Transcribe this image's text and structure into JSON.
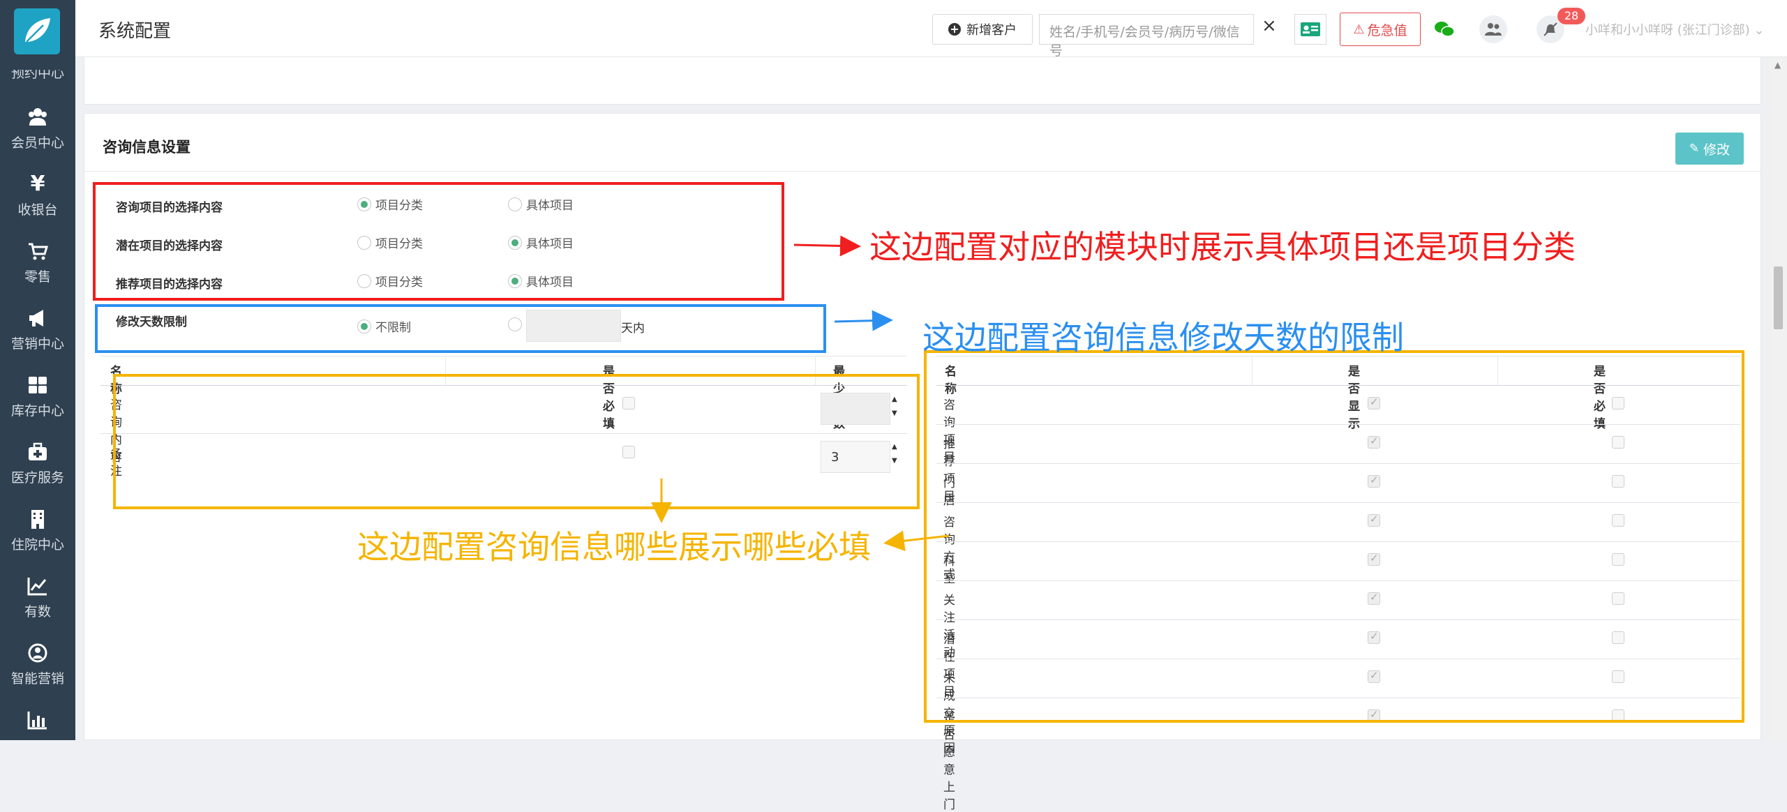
{
  "sidebar": {
    "items": [
      {
        "label": "预约中心",
        "icon": "calendar-icon"
      },
      {
        "label": "会员中心",
        "icon": "members-icon"
      },
      {
        "label": "收银台",
        "icon": "yen-icon"
      },
      {
        "label": "零售",
        "icon": "cart-icon"
      },
      {
        "label": "营销中心",
        "icon": "megaphone-icon"
      },
      {
        "label": "库存中心",
        "icon": "grid-icon"
      },
      {
        "label": "医疗服务",
        "icon": "medkit-icon"
      },
      {
        "label": "住院中心",
        "icon": "building-icon"
      },
      {
        "label": "有数",
        "icon": "line-chart-icon"
      },
      {
        "label": "智能营销",
        "icon": "smart-icon"
      },
      {
        "label": "",
        "icon": "bar-chart-icon"
      }
    ]
  },
  "topbar": {
    "title": "系统配置",
    "add_customer": "新增客户",
    "search_placeholder": "姓名/手机号/会员号/病历号/微信号",
    "clear": "×",
    "danger_label": "危急值",
    "notification_count": "28",
    "user": "小咩和小小咩呀 (张江门诊部)"
  },
  "panel": {
    "title": "咨询信息设置",
    "edit_button": "修改"
  },
  "selection_rows": [
    {
      "label": "咨询项目的选择内容",
      "option_a": "项目分类",
      "option_b": "具体项目",
      "selected": "a"
    },
    {
      "label": "潜在项目的选择内容",
      "option_a": "项目分类",
      "option_b": "具体项目",
      "selected": "b"
    },
    {
      "label": "推荐项目的选择内容",
      "option_a": "项目分类",
      "option_b": "具体项目",
      "selected": "b"
    }
  ],
  "days_limit": {
    "label": "修改天数限制",
    "no_limit": "不限制",
    "unit": "天内"
  },
  "left_table": {
    "headers": [
      "名称",
      "是否必填",
      "最少字数"
    ],
    "rows": [
      {
        "name": "咨询内容",
        "required": false,
        "min_chars": ""
      },
      {
        "name": "备注",
        "required": false,
        "min_chars": "3"
      }
    ]
  },
  "right_table": {
    "headers": [
      "名称",
      "是否显示",
      "是否必填"
    ],
    "rows": [
      {
        "name": "咨询项目",
        "show": true,
        "required": false
      },
      {
        "name": "推荐项目",
        "show": true,
        "required": false
      },
      {
        "name": "门店",
        "show": true,
        "required": false
      },
      {
        "name": "咨询方式",
        "show": true,
        "required": false
      },
      {
        "name": "科室",
        "show": true,
        "required": false
      },
      {
        "name": "关注活动",
        "show": true,
        "required": false
      },
      {
        "name": "潜在项目",
        "show": true,
        "required": false
      },
      {
        "name": "未成交原因",
        "show": true,
        "required": false
      },
      {
        "name": "是否愿意上门",
        "show": true,
        "required": false
      }
    ]
  },
  "annotations": {
    "red": "这边配置对应的模块时展示具体项目还是项目分类",
    "blue": "这边配置咨询信息修改天数的限制",
    "orange": "这边配置咨询信息哪些展示哪些必填"
  },
  "colors": {
    "sidebar_bg": "#2f4050",
    "accent_teal": "#5cc4c8",
    "radio_green": "#4cae7c",
    "annot_red": "#f01e1e",
    "annot_blue": "#2b8ff0",
    "annot_orange": "#f5b400"
  }
}
